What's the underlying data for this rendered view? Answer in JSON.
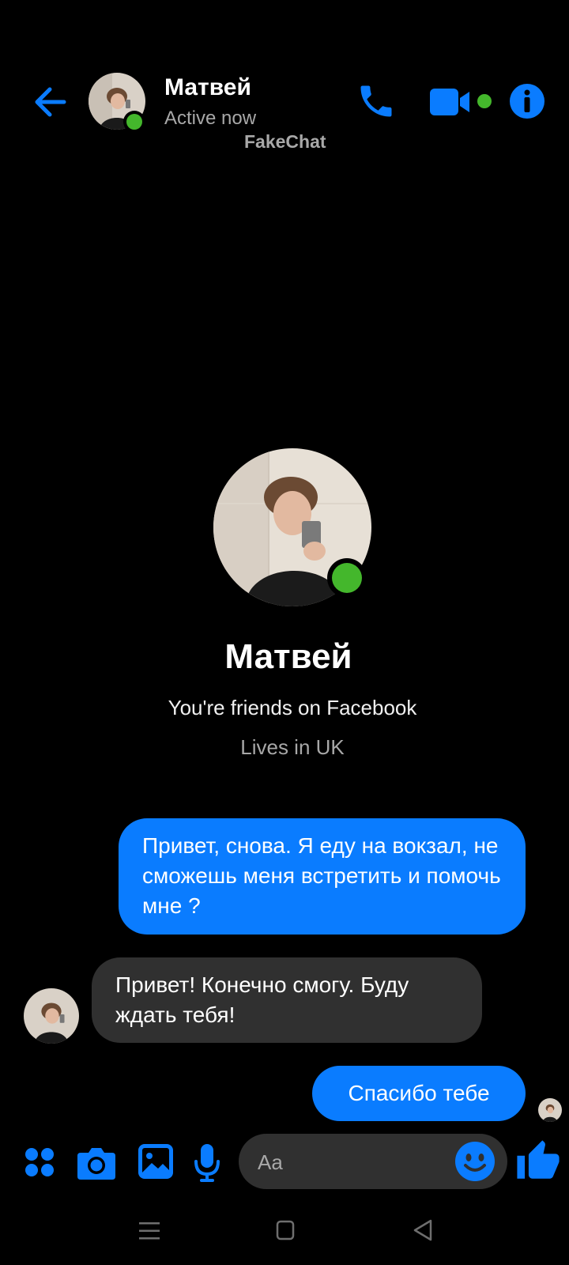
{
  "header": {
    "contact_name": "Матвей",
    "status": "Active now",
    "watermark": "FakeChat"
  },
  "profile": {
    "name": "Матвей",
    "friends_text": "You're friends on Facebook",
    "lives_text": "Lives in UK"
  },
  "messages": [
    {
      "direction": "outgoing",
      "text": "Привет, снова. Я еду на вокзал, не сможешь меня встретить и помочь мне ?"
    },
    {
      "direction": "incoming",
      "text": "Привет! Конечно смогу. Буду ждать тебя!"
    },
    {
      "direction": "outgoing",
      "text": "Спасибо тебе"
    }
  ],
  "composer": {
    "placeholder": "Aa"
  },
  "icons": {
    "back": "arrow-left-icon",
    "call": "phone-icon",
    "video": "video-camera-icon",
    "info": "info-icon",
    "apps": "apps-grid-icon",
    "camera": "camera-icon",
    "gallery": "gallery-icon",
    "mic": "microphone-icon",
    "emoji": "emoji-icon",
    "like": "thumbs-up-icon"
  },
  "colors": {
    "accent": "#0a7cff",
    "online": "#44b72c",
    "incoming_bubble": "#303030",
    "background": "#000000"
  }
}
